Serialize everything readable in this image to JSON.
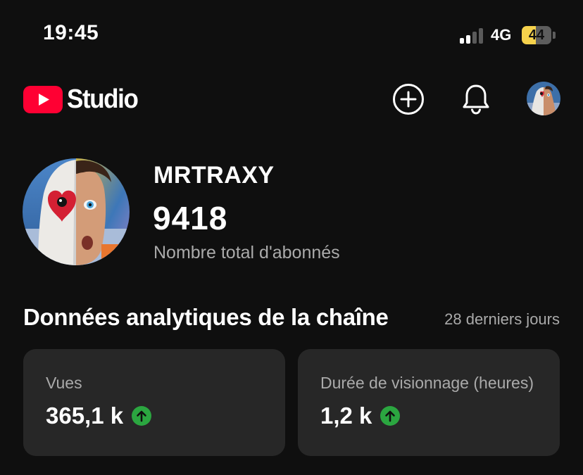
{
  "status_bar": {
    "time": "19:45",
    "network": "4G",
    "battery": "44",
    "signal_bars_filled": 2,
    "signal_bars_total": 4
  },
  "header": {
    "app_name": "Studio",
    "icons": [
      "youtube-logo-icon",
      "create-plus-icon",
      "notifications-bell-icon",
      "account-avatar"
    ]
  },
  "channel": {
    "name": "MRTRAXY",
    "subscribers": "9418",
    "subscribers_label": "Nombre total d'abonnés"
  },
  "analytics": {
    "title": "Données analytiques de la chaîne",
    "period": "28 derniers jours",
    "cards": [
      {
        "label": "Vues",
        "value": "365,1 k",
        "trend": "up"
      },
      {
        "label": "Durée de visionnage (heures)",
        "value": "1,2 k",
        "trend": "up"
      }
    ]
  },
  "colors": {
    "background": "#0f0f0f",
    "card": "#272727",
    "brand_red": "#ff0033",
    "trend_up": "#2ba640",
    "battery": "#f6d24c",
    "secondary_text": "#aaaaaa"
  }
}
